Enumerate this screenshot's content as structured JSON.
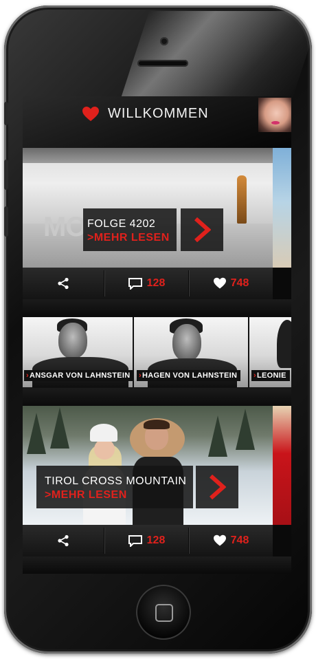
{
  "header": {
    "title": "WILLKOMMEN",
    "heart_icon": "heart-icon",
    "accent": "#e0211c"
  },
  "feed": {
    "card1": {
      "prefix": "MO",
      "title": "FOLGE 4202",
      "more": ">MEHR LESEN"
    },
    "card1_actions": {
      "comments": "128",
      "likes": "748"
    },
    "people": [
      {
        "name": "ANSGAR VON LAHNSTEIN"
      },
      {
        "name": "HAGEN VON LAHNSTEIN"
      },
      {
        "name": "LEONIE"
      }
    ],
    "card2": {
      "title": "TIROL CROSS MOUNTAIN",
      "more": ">MEHR LESEN"
    },
    "card2_actions": {
      "comments": "128",
      "likes": "748"
    }
  },
  "colors": {
    "accent_red": "#e0211c",
    "bar_bg": "#1e1e1e",
    "text_white": "#ffffff"
  }
}
